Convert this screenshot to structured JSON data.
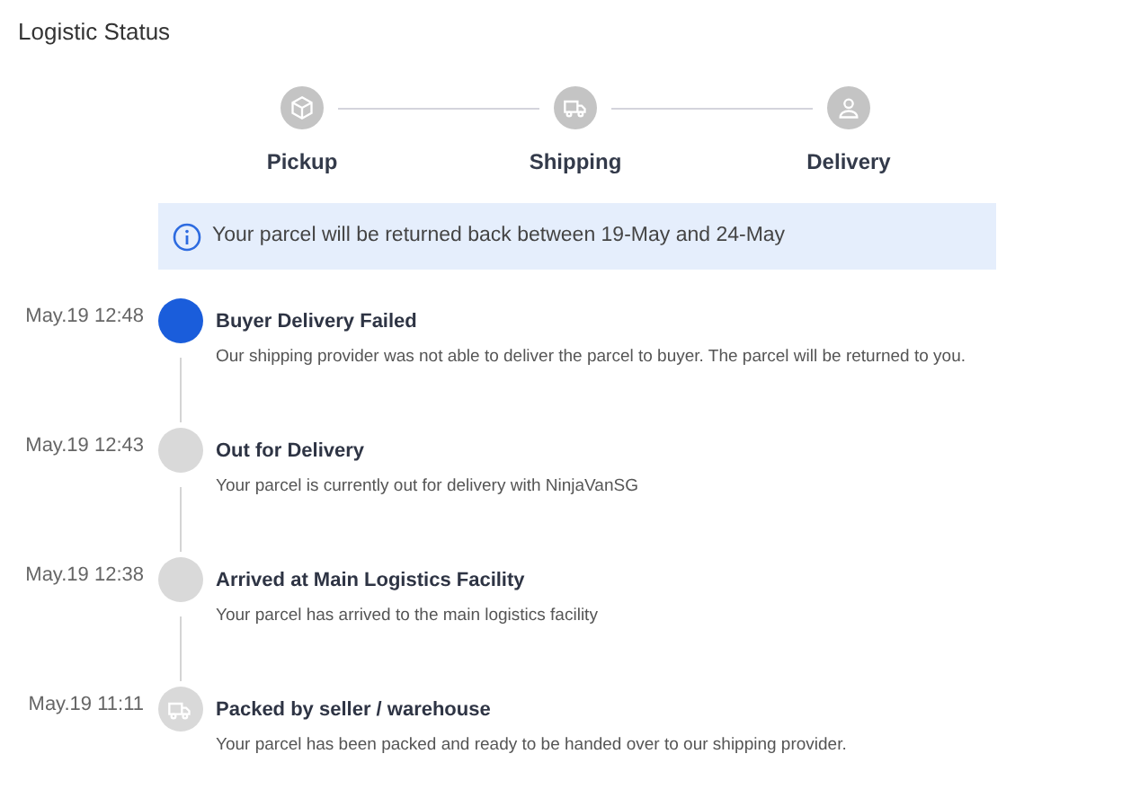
{
  "title": "Logistic Status",
  "steps": [
    {
      "label": "Pickup",
      "kind": "box"
    },
    {
      "label": "Shipping",
      "kind": "truck"
    },
    {
      "label": "Delivery",
      "kind": "person"
    }
  ],
  "notice": "Your parcel will be returned back between 19-May and 24-May",
  "events": [
    {
      "time": "May.19 12:48",
      "title": "Buyer Delivery Failed",
      "detail": "Our shipping provider was not able to deliver the parcel to buyer. The parcel will be returned to you.",
      "current": true,
      "kind": "dot"
    },
    {
      "time": "May.19 12:43",
      "title": "Out for Delivery",
      "detail": "Your parcel is currently out for delivery with NinjaVanSG",
      "current": false,
      "kind": "dot"
    },
    {
      "time": "May.19 12:38",
      "title": "Arrived at Main Logistics Facility",
      "detail": "Your parcel has arrived to the main logistics facility",
      "current": false,
      "kind": "dot"
    },
    {
      "time": "May.19 11:11",
      "title": "Packed by seller / warehouse",
      "detail": "Your parcel has been packed and ready to be handed over to our shipping provider.",
      "current": false,
      "kind": "truck"
    }
  ]
}
